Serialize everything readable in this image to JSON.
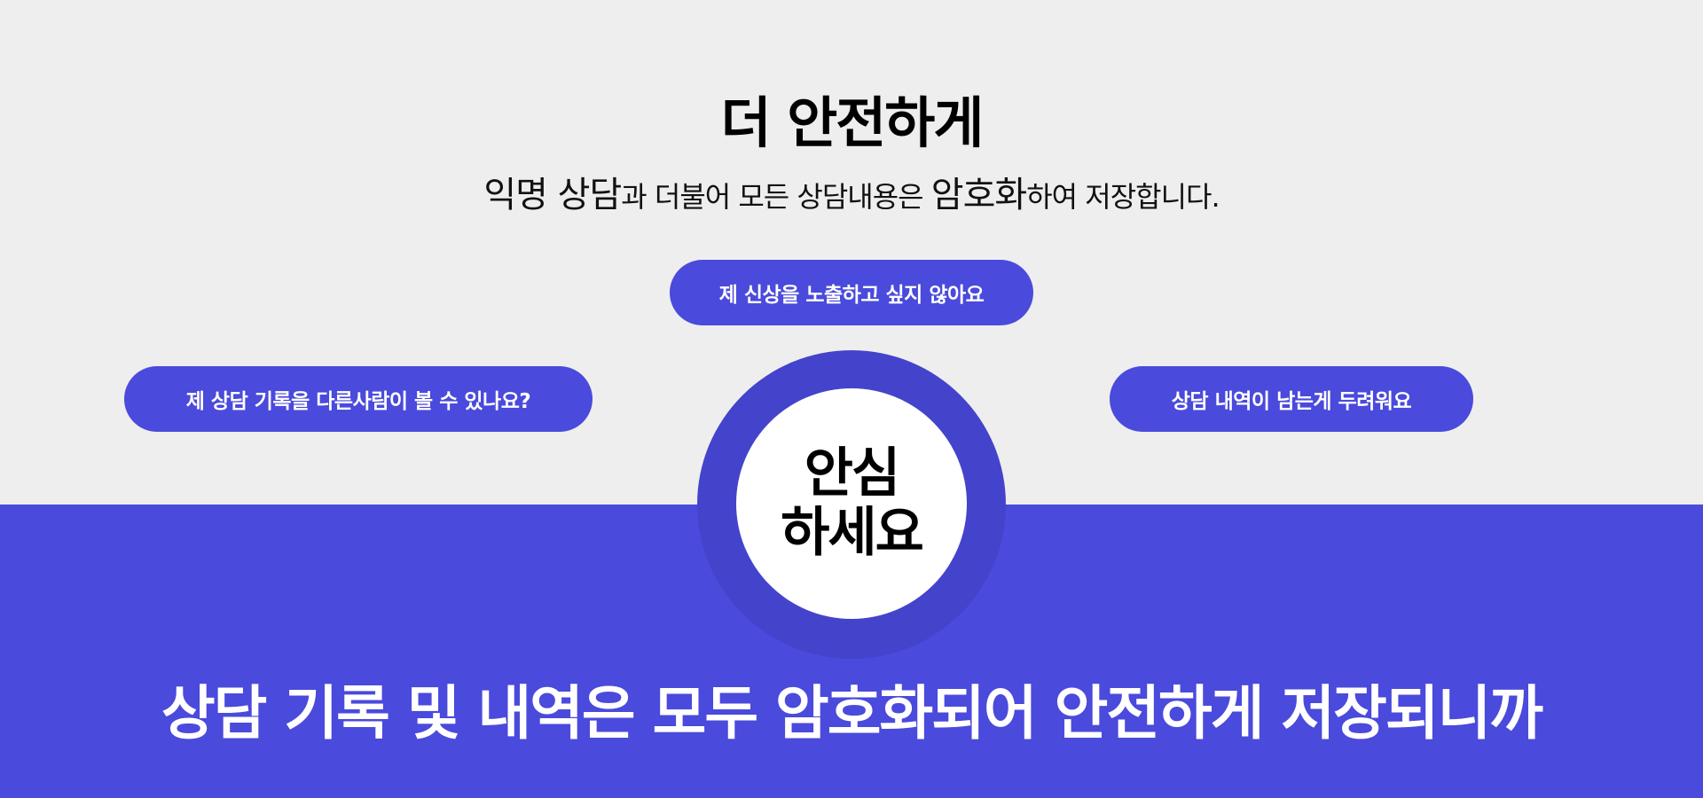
{
  "heading": "더 안전하게",
  "subheading": {
    "part1": "익명 상담",
    "part2": "과 더불어 모든 상담내용은 ",
    "part3": "암호화",
    "part4": "하여 저장합니다."
  },
  "pills": {
    "top": "제 신상을 노출하고 싶지 않아요",
    "left": "제 상담 기록을 다른사람이 볼 수 있나요?",
    "right": "상담 내역이 남는게 두려워요"
  },
  "circle": {
    "line1": "안심",
    "line2": "하세요"
  },
  "bottom_text": "상담 기록 및 내역은 모두 암호화되어 안전하게 저장되니까",
  "colors": {
    "accent": "#4a4adc",
    "ring": "#4343cc",
    "background": "#eeeeee"
  }
}
